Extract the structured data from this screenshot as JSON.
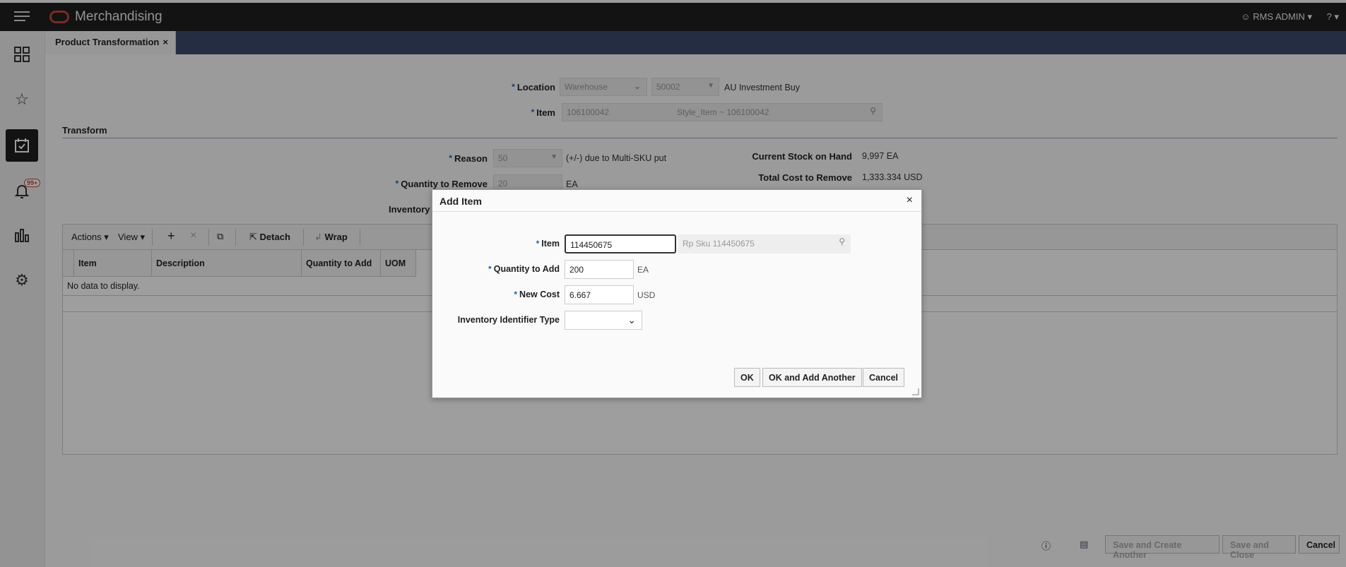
{
  "topbar": {
    "title": "Merchandising",
    "user": "RMS ADMIN ▾",
    "help": "? ▾"
  },
  "tab": {
    "label": "Product Transformation",
    "close": "×"
  },
  "form": {
    "location_label": "Location",
    "location_type": "Warehouse",
    "location_id": "50002",
    "location_name": "AU Investment Buy",
    "item_label": "Item",
    "item_value": "106100042",
    "item_desc": "Style_Item ~ 106100042",
    "section_title": "Transform",
    "reason_label": "Reason",
    "reason_value": "50",
    "reason_desc": "(+/-) due to Multi-SKU put",
    "qty_remove_label": "Quantity to Remove",
    "qty_remove_value": "20",
    "qty_remove_unit": "EA",
    "inventory_label": "Inventory",
    "stock_label": "Current Stock on Hand",
    "stock_value": "9,997 EA",
    "cost_label": "Total Cost to Remove",
    "cost_value": "1,333.334 USD"
  },
  "toolbar": {
    "actions": "Actions ▾",
    "view": "View ▾",
    "add": "+",
    "remove": "×",
    "detach": "Detach",
    "wrap": "Wrap"
  },
  "table": {
    "columns": [
      "Item",
      "Description",
      "Quantity to Add",
      "UOM"
    ],
    "empty": "No data to display."
  },
  "footer": {
    "save_create": "Save and Create Another",
    "save_close": "Save and Close",
    "cancel": "Cancel"
  },
  "dialog": {
    "title": "Add Item",
    "close": "×",
    "item_label": "Item",
    "item_value": "114450675",
    "item_desc": "Rp Sku 114450675",
    "qty_label": "Quantity to Add",
    "qty_value": "200",
    "qty_unit": "EA",
    "cost_label": "New Cost",
    "cost_value": "6.667",
    "cost_unit": "USD",
    "inv_type_label": "Inventory Identifier Type",
    "inv_type_value": "",
    "ok": "OK",
    "ok_add": "OK and Add Another",
    "cancel": "Cancel"
  }
}
